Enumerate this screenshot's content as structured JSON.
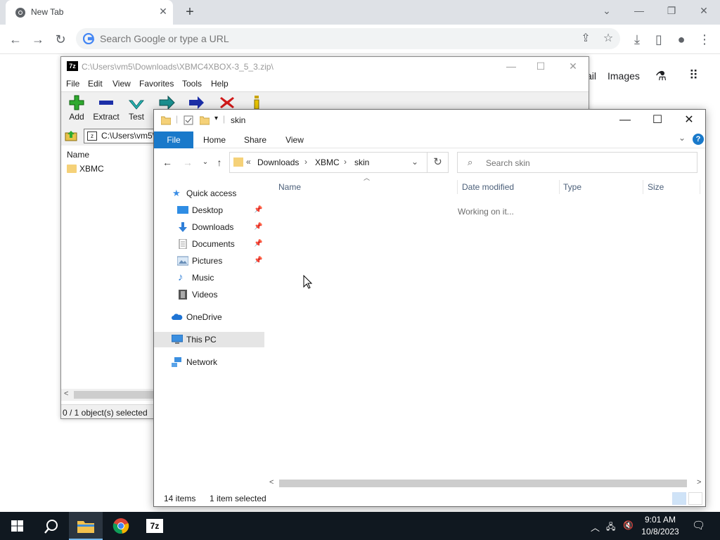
{
  "chrome": {
    "tab_title": "New Tab",
    "omnibox_placeholder": "Search Google or type a URL",
    "ntp_link_partial": "ail",
    "ntp_images": "Images"
  },
  "sevenzip": {
    "title": "C:\\Users\\vm5\\Downloads\\XBMC4XBOX-3_5_3.zip\\",
    "logo": "7z",
    "menu": [
      "File",
      "Edit",
      "View",
      "Favorites",
      "Tools",
      "Help"
    ],
    "tools": [
      "Add",
      "Extract",
      "Test"
    ],
    "path": "C:\\Users\\vm5\\",
    "column_name": "Name",
    "rows": [
      "XBMC"
    ],
    "status": "0 / 1 object(s) selected"
  },
  "explorer": {
    "title": "skin",
    "ribbon_tabs": [
      "File",
      "Home",
      "Share",
      "View"
    ],
    "breadcrumb_prefix": "«",
    "breadcrumb": [
      "Downloads",
      "XBMC",
      "skin"
    ],
    "search_placeholder": "Search skin",
    "nav": {
      "quick_access": "Quick access",
      "desktop": "Desktop",
      "downloads": "Downloads",
      "documents": "Documents",
      "pictures": "Pictures",
      "music": "Music",
      "videos": "Videos",
      "onedrive": "OneDrive",
      "this_pc": "This PC",
      "network": "Network"
    },
    "columns": [
      "Name",
      "Date modified",
      "Type",
      "Size"
    ],
    "working_text": "Working on it...",
    "status_items": "14 items",
    "status_selected": "1 item selected"
  },
  "taskbar": {
    "time": "9:01 AM",
    "date": "10/8/2023",
    "sevenzip_label": "7z"
  },
  "colors": {
    "accent": "#1979ca",
    "taskbar": "#101820",
    "tabstrip": "#dee1e6"
  }
}
